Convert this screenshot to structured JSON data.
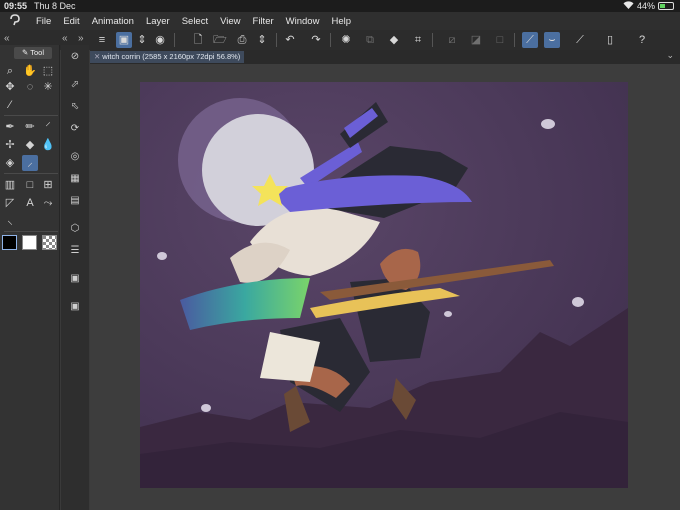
{
  "status_bar": {
    "time": "09:55",
    "date": "Thu 8 Dec",
    "battery": "44%",
    "battery_level": 0.44
  },
  "menu": [
    "File",
    "Edit",
    "Animation",
    "Layer",
    "Select",
    "View",
    "Filter",
    "Window",
    "Help"
  ],
  "tool_panel": {
    "tab_label": "Tool"
  },
  "document": {
    "tab_title": "witch corrin (2585 x 2160px 72dpi 56.8%)"
  },
  "colors": {
    "accent": "#4b6fa0",
    "canvas_bg": "#4a3656",
    "moon": "#d2d0da",
    "hat": "#2a2a34",
    "hat_band": "#6b5fd6"
  }
}
